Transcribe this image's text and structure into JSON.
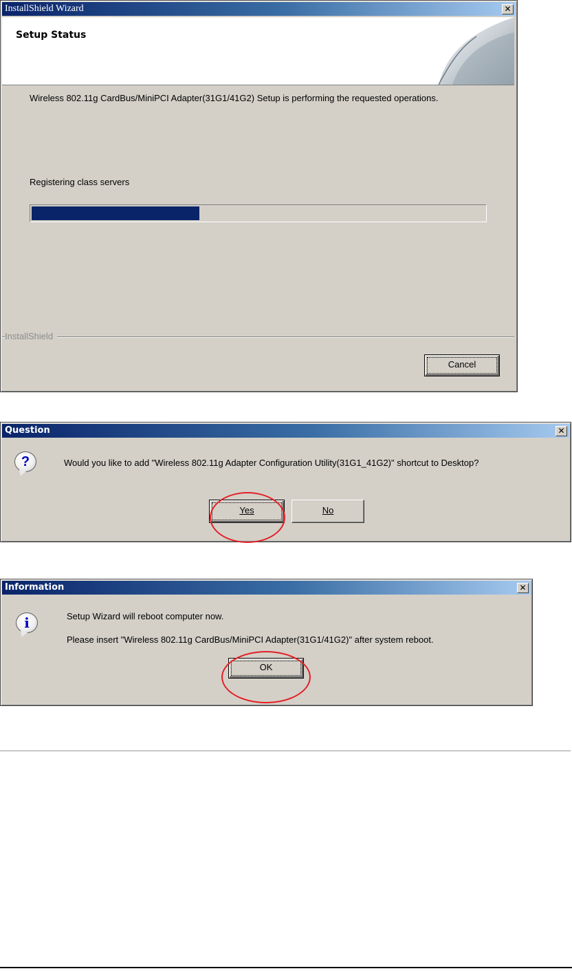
{
  "wizard": {
    "title": "InstallShield Wizard",
    "close_glyph": "✕",
    "header_title": "Setup Status",
    "description": "Wireless 802.11g CardBus/MiniPCI Adapter(31G1/41G2) Setup is performing the requested operations.",
    "status": "Registering class servers",
    "progress_percent": 37,
    "brand_label": "InstallShield",
    "cancel_label": "Cancel"
  },
  "question_dialog": {
    "title": "Question",
    "close_glyph": "✕",
    "icon": "question-icon",
    "icon_glyph": "?",
    "message": "Would you like to add \"Wireless 802.11g Adapter Configuration Utility(31G1_41G2)\" shortcut to Desktop?",
    "yes_label": "Yes",
    "no_label": "No"
  },
  "info_dialog": {
    "title": "Information",
    "close_glyph": "✕",
    "icon": "information-icon",
    "icon_glyph": "i",
    "line1": "Setup Wizard will reboot computer now.",
    "line2": "Please insert \"Wireless 802.11g CardBus/MiniPCI Adapter(31G1/41G2)\" after system reboot.",
    "ok_label": "OK"
  },
  "colors": {
    "progress_fill": "#0a246a",
    "highlight_ring": "#e41e25",
    "dialog_face": "#d4d0c8"
  }
}
